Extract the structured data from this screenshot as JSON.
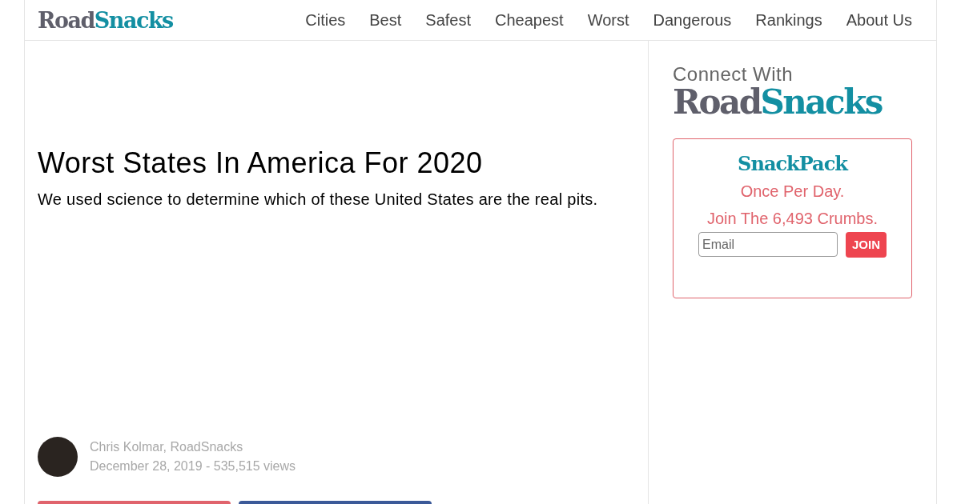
{
  "header": {
    "logo": {
      "part_1": "Road",
      "part_2": "Snacks"
    },
    "nav": [
      {
        "label": "Cities"
      },
      {
        "label": "Best"
      },
      {
        "label": "Safest"
      },
      {
        "label": "Cheapest"
      },
      {
        "label": "Worst"
      },
      {
        "label": "Dangerous"
      },
      {
        "label": "Rankings"
      },
      {
        "label": "About Us"
      }
    ]
  },
  "article": {
    "title": "Worst States In America For 2020",
    "subtitle": "We used science to determine which of these United States are the real pits.",
    "author": "Chris Kolmar, RoadSnacks",
    "meta": "December 28, 2019 - 535,515 views",
    "share_buttons": [
      {
        "color": "#e0636c"
      },
      {
        "color": "#3b5998"
      }
    ]
  },
  "sidebar": {
    "connect_heading": "Connect With",
    "logo": {
      "part_1": "Road",
      "part_2": "Snacks"
    },
    "signup": {
      "title": "SnackPack",
      "line_1": "Once Per Day.",
      "line_2": "Join The 6,493 Crumbs.",
      "email": {
        "placeholder": "Email"
      },
      "button": "JOIN"
    }
  }
}
